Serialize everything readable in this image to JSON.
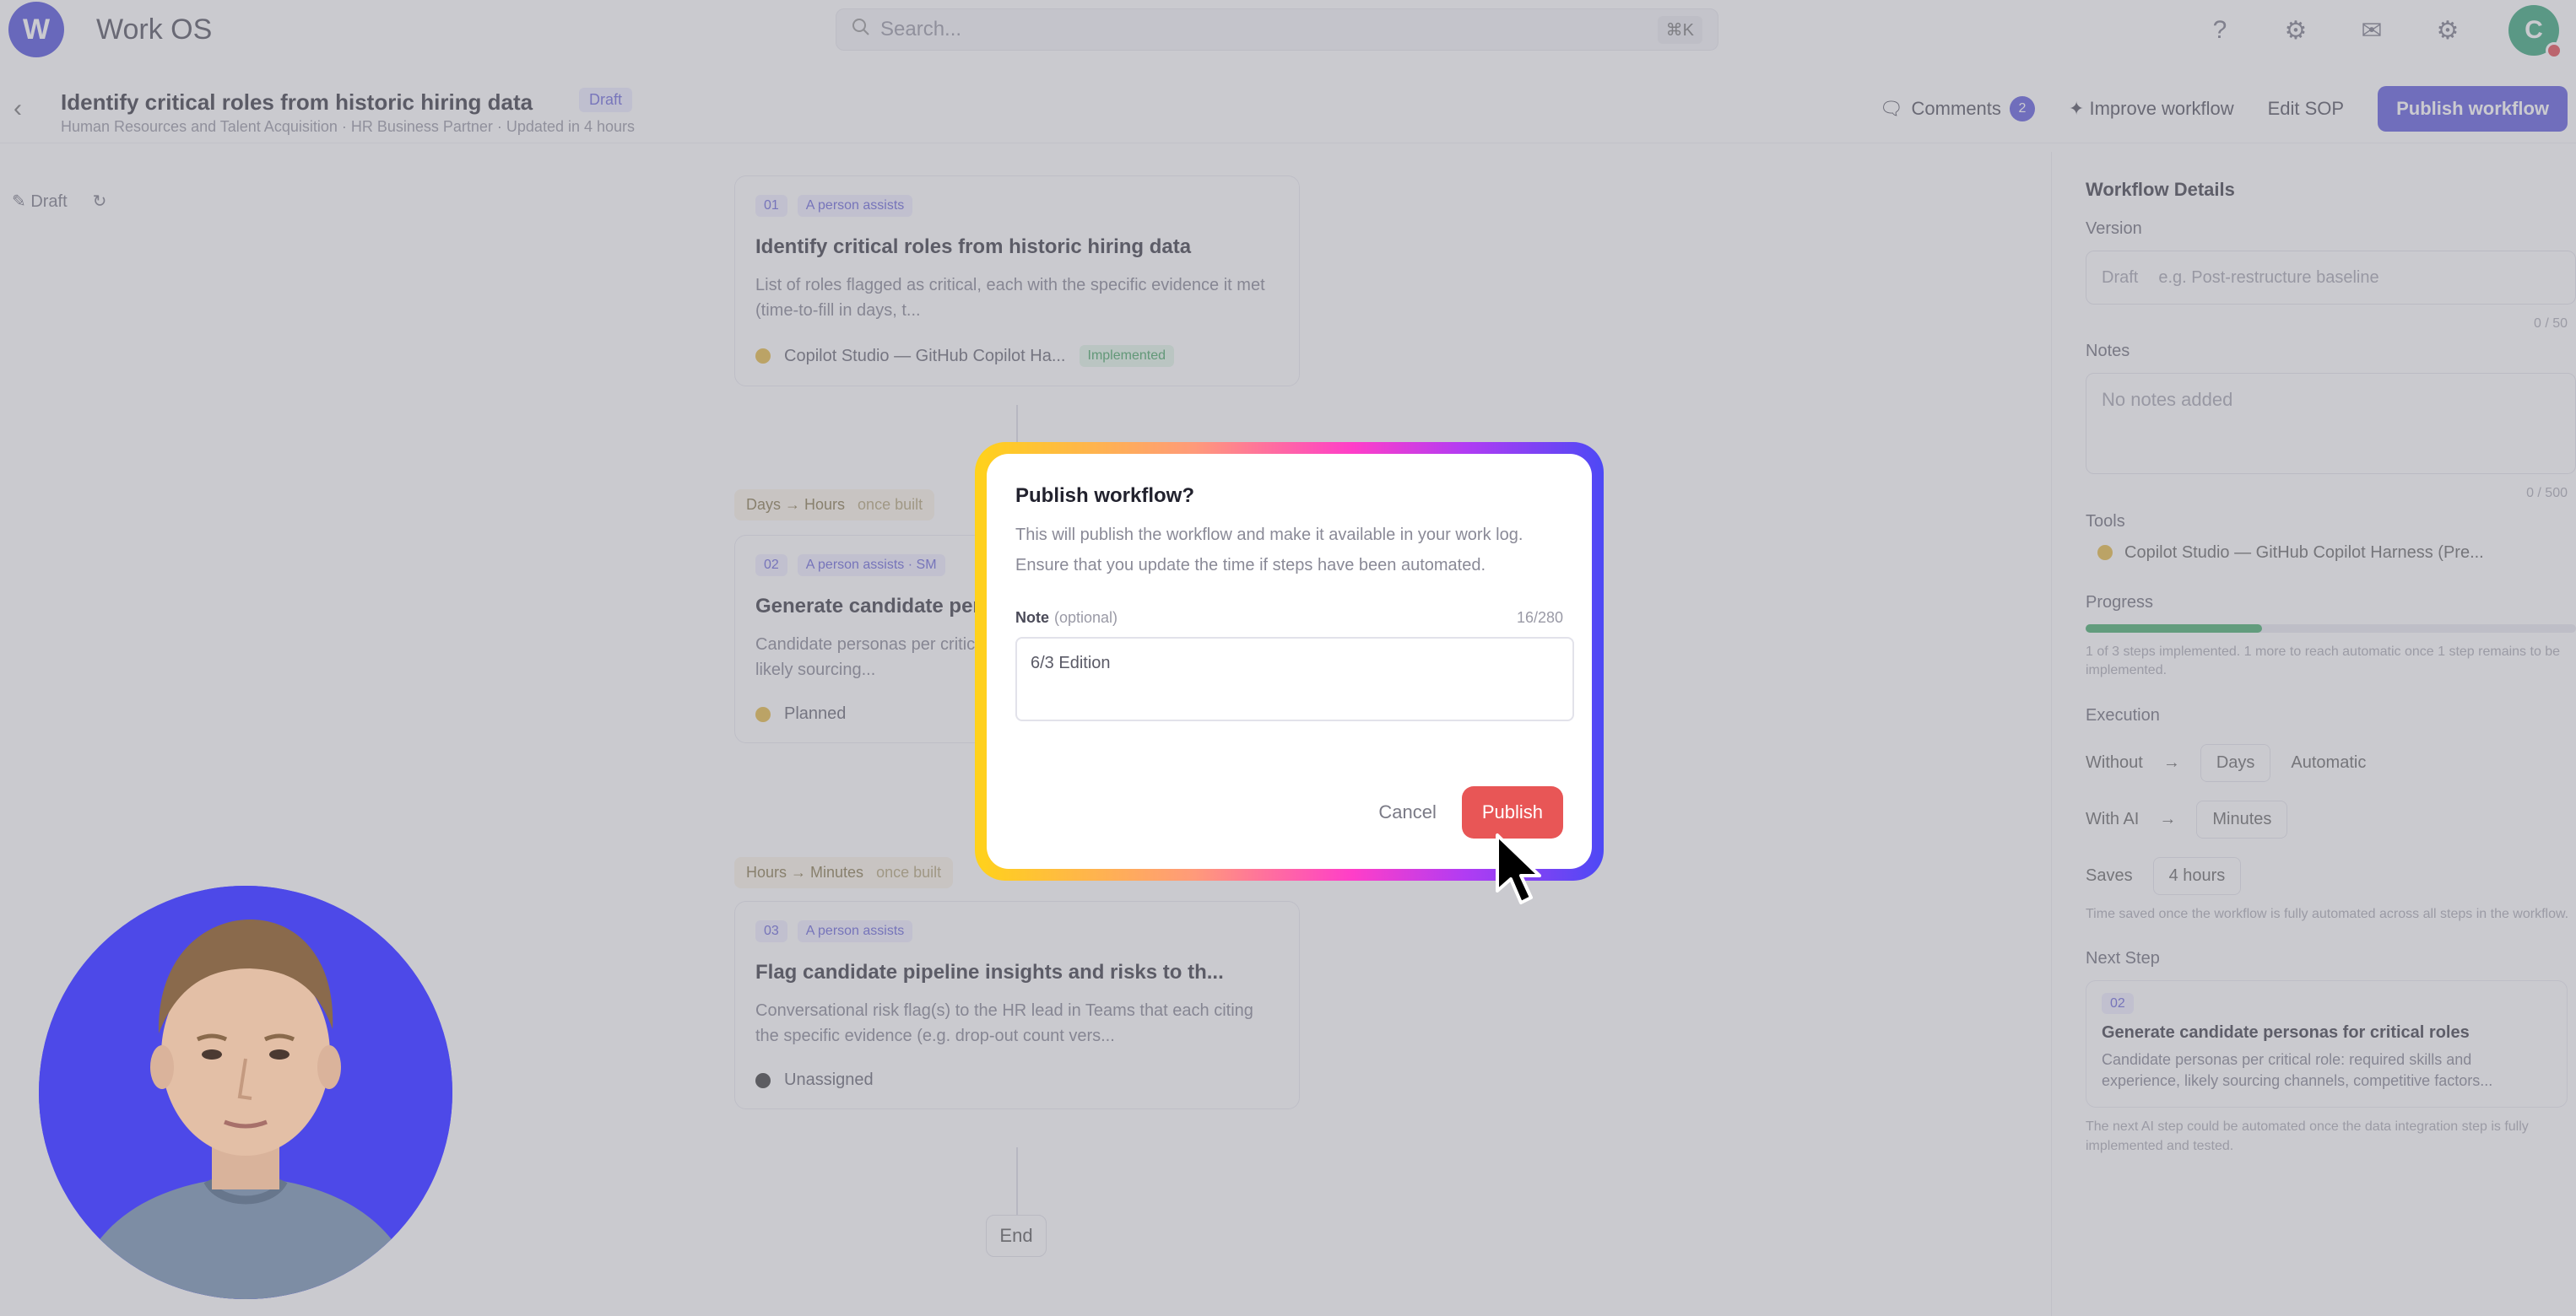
{
  "app": {
    "logo_letter": "W",
    "title": "Work OS"
  },
  "search": {
    "placeholder": "Search...",
    "shortcut": "⌘K"
  },
  "top_icons": [
    "help-icon",
    "bell-icon",
    "notification-icon",
    "settings-icon"
  ],
  "user": {
    "initial": "C"
  },
  "header": {
    "title": "Identify critical roles from historic hiring data",
    "status": "Draft",
    "subtitle": "Human Resources and Talent Acquisition · HR Business Partner · Updated in 4 hours",
    "comments_label": "Comments",
    "comments_count": "2",
    "improve_label": "Improve workflow",
    "edit_sop_label": "Edit SOP",
    "publish_label": "Publish workflow"
  },
  "left_tools": {
    "draft_label": "Draft"
  },
  "canvas": {
    "cards": [
      {
        "tag_num": "01",
        "tag_label": "A person assists",
        "title": "Identify critical roles from historic hiring data",
        "desc": "List of roles flagged as critical, each with the specific evidence it met (time-to-fill in days, t...",
        "tool": "Copilot Studio — GitHub Copilot Ha...",
        "tool_status": "Implemented"
      },
      {
        "lane": "Days → Hours",
        "lane_extra": "once built",
        "tag_num": "02",
        "tag_label": "A person assists · SM",
        "title": "Generate candidate personas",
        "desc": "Candidate personas per critical role: required skills and experience, likely sourcing...",
        "tool": "Planned"
      },
      {
        "lane": "Hours → Minutes",
        "lane_extra": "once built",
        "tag_num": "03",
        "tag_label": "A person assists",
        "title": "Flag candidate pipeline insights and risks to th...",
        "desc": "Conversational risk flag(s) to the HR lead in Teams that each citing the specific evidence (e.g. drop-out count vers...",
        "tool": "Unassigned"
      }
    ],
    "end_label": "End"
  },
  "right_panel": {
    "heading": "Workflow Details",
    "version_label": "Version",
    "version_prefix": "Draft",
    "version_placeholder": "e.g. Post-restructure baseline",
    "version_counter": "0 / 50",
    "notes_label": "Notes",
    "notes_value": "No notes added",
    "notes_counter": "0 / 500",
    "tools_label": "Tools",
    "tools_value": "Copilot Studio — GitHub Copilot Harness (Pre...",
    "progress_label": "Progress",
    "progress_fraction": 0.36,
    "progress_note": "1 of 3 steps implemented. 1 more to reach automatic once 1 step remains to be implemented.",
    "execution_label": "Execution",
    "exec_rows": [
      {
        "label": "Without",
        "arrow": "→",
        "value": "Days",
        "extra": "Automatic"
      },
      {
        "label": "With AI",
        "arrow": "→",
        "value": "Minutes",
        "extra": ""
      },
      {
        "label": "Saves",
        "arrow": "",
        "value": "4 hours",
        "extra": ""
      }
    ],
    "exec_note": "Time saved once the workflow is fully automated across all steps in the workflow.",
    "next_step_label": "Next Step",
    "next_tag": "02",
    "next_title": "Generate candidate personas for critical roles",
    "next_desc": "Candidate personas per critical role: required skills and experience, likely sourcing channels, competitive factors...",
    "next_note": "The next AI step could be automated once the data integration step is fully implemented and tested."
  },
  "modal": {
    "title": "Publish workflow?",
    "description": "This will publish the workflow and make it available in your work log. Ensure that you update the time if steps have been automated.",
    "note_label": "Note",
    "note_optional": "(optional)",
    "note_counter": "16/280",
    "note_value": "6/3 Edition",
    "cancel_label": "Cancel",
    "publish_label": "Publish"
  }
}
